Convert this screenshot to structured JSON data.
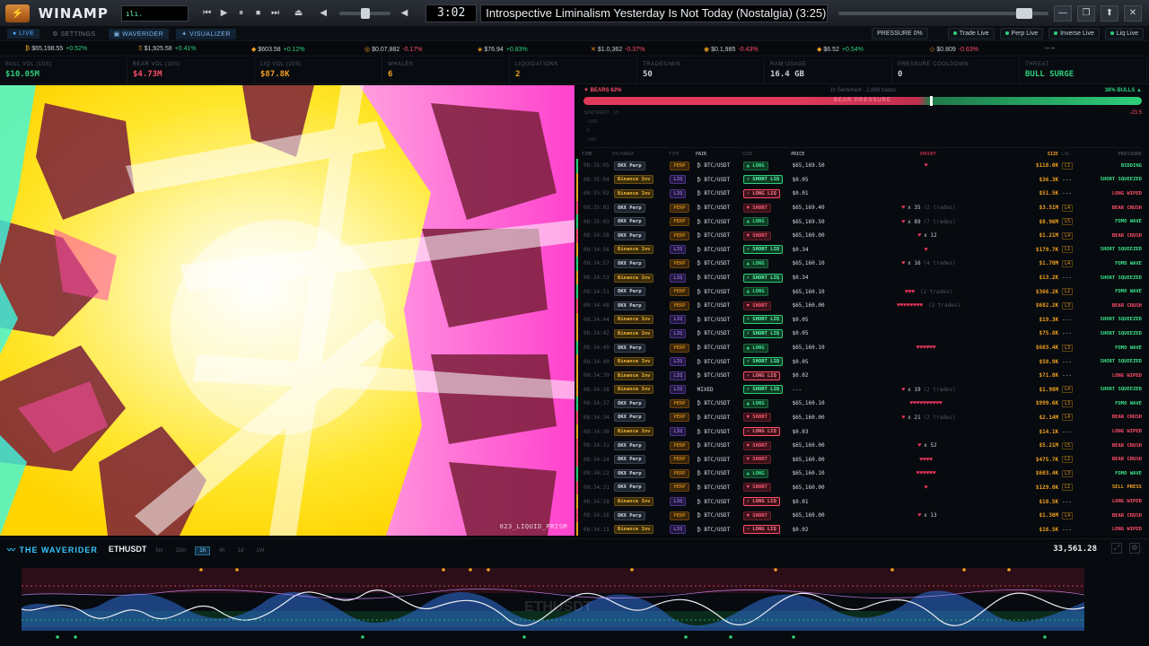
{
  "winamp": {
    "logo": "⚡",
    "title": "WINAMP",
    "vis_text": "ılı.",
    "controls": [
      "⏮",
      "▶",
      "⏸",
      "⏹",
      "⏭",
      "⏏"
    ],
    "time": "3:02",
    "song": "Introspective Liminalism Yesterday Is Not Today (Nostalgia) (3:25)",
    "window_buttons": [
      "—",
      "❐",
      "⬆",
      "✕"
    ]
  },
  "nav": {
    "items": [
      {
        "label": "● LIVE",
        "active": true
      },
      {
        "label": "⚙ SETTINGS",
        "active": false
      },
      {
        "label": "▣ WAVERIDER",
        "active": true
      },
      {
        "label": "✦ VISUALIZER",
        "active": true
      }
    ],
    "status": [
      "PRESSURE 0%",
      "Trade Live",
      "Perp Live",
      "Inverse Live",
      "Liq Live"
    ]
  },
  "ticker": [
    {
      "icon": "₿",
      "price": "$65,198.55",
      "chg": "+0.52%",
      "dir": "up"
    },
    {
      "icon": "Ξ",
      "price": "$1,925.58",
      "chg": "+0.41%",
      "dir": "up"
    },
    {
      "icon": "◆",
      "price": "$603.58",
      "chg": "+0.12%",
      "dir": "up"
    },
    {
      "icon": "◎",
      "price": "$0.07,882",
      "chg": "-0.17%",
      "dir": "dn"
    },
    {
      "icon": "◈",
      "price": "$76.94",
      "chg": "+0.83%",
      "dir": "up"
    },
    {
      "icon": "✕",
      "price": "$1.0,362",
      "chg": "-0.37%",
      "dir": "dn"
    },
    {
      "icon": "◉",
      "price": "$0.1,985",
      "chg": "-0.43%",
      "dir": "dn"
    },
    {
      "icon": "◆",
      "price": "$6.52",
      "chg": "+0.54%",
      "dir": "up"
    },
    {
      "icon": "◇",
      "price": "$0.809",
      "chg": "-0.63%",
      "dir": "dn"
    },
    {
      "icon": "",
      "price": "-- --",
      "chg": "",
      "dir": "up"
    }
  ],
  "stats": [
    {
      "label": "BULL VOL (10S)",
      "value": "$10.05M",
      "color": "#2ecf7a"
    },
    {
      "label": "BEAR VOL (10S)",
      "value": "$4.73M",
      "color": "#ff4d6a"
    },
    {
      "label": "LIQ VOL (10S)",
      "value": "$87.8K",
      "color": "#f0a020"
    },
    {
      "label": "WHALES",
      "value": "6",
      "color": "#f0a020"
    },
    {
      "label": "LIQUIDATIONS",
      "value": "2",
      "color": "#f0a020"
    },
    {
      "label": "TRADES/MIN",
      "value": "50",
      "color": "#c8d0da"
    },
    {
      "label": "RAM USAGE",
      "value": "16.4 GB",
      "color": "#c8d0da"
    },
    {
      "label": "PRESSURE COOLDOWN",
      "value": "0",
      "color": "#c8d0da"
    },
    {
      "label": "THREAT",
      "value": "BULL SURGE",
      "color": "#2ecf7a"
    }
  ],
  "visualizer": {
    "preset": "023_LIQUID_PRISM"
  },
  "sentiment": {
    "bears": "▼ BEARS 62%",
    "center": "1h Sentiment · 2,888 trades",
    "bulls": "38% BULLS ▲",
    "bar_label": "BEAR PRESSURE",
    "bear_fraction": 0.62,
    "chart_label": "SENTIMENT · 1H",
    "chart_value": "-23.5",
    "axis": [
      "+100",
      "0",
      "-100"
    ]
  },
  "trade_headers": [
    "TIME",
    "EXCHANGE",
    "TYPE",
    "PAIR",
    "SIDE",
    "PRICE",
    "AMOUNT",
    "SIZE",
    "LVL",
    "PRESSURE"
  ],
  "trades": [
    {
      "time": "08:35:05",
      "ex": "OKX Perp",
      "type": "PERP",
      "pair": "₿ BTC/USDT",
      "side": "▲ LONG",
      "sc": "long",
      "price": "$65,169.50",
      "amt": "♥",
      "cnt": "",
      "tn": "",
      "size": "$118.0K",
      "lvl": "L1",
      "pr": "BIDDING",
      "pc": "p-g",
      "row": "bull"
    },
    {
      "time": "08:35:04",
      "ex": "Binance Inv",
      "type": "LIQ",
      "pair": "₿ BTC/USDT",
      "side": "⚡ SHORT LIQ",
      "sc": "sliq",
      "price": "$0.05",
      "amt": "",
      "cnt": "",
      "tn": "",
      "size": "$36.3K",
      "lvl": "---",
      "pr": "SHORT SQUEEZED",
      "pc": "p-g",
      "row": "liq"
    },
    {
      "time": "08:35:02",
      "ex": "Binance Inv",
      "type": "LIQ",
      "pair": "₿ BTC/USDT",
      "side": "⚡ LONG LIQ",
      "sc": "lliq",
      "price": "$0.01",
      "amt": "",
      "cnt": "",
      "tn": "",
      "size": "$51.5K",
      "lvl": "---",
      "pr": "LONG WIPED",
      "pc": "p-r",
      "row": "liq"
    },
    {
      "time": "08:35:03",
      "ex": "OKX Perp",
      "type": "PERP",
      "pair": "₿ BTC/USDT",
      "side": "▼ SHORT",
      "sc": "short",
      "price": "$65,169.40",
      "amt": "♥",
      "cnt": "x 35",
      "tn": "(2 trades)",
      "size": "$3.51M",
      "lvl": "L4",
      "pr": "BEAR CRUSH",
      "pc": "p-r",
      "row": "bear"
    },
    {
      "time": "08:35:03",
      "ex": "OKX Perp",
      "type": "PERP",
      "pair": "₿ BTC/USDT",
      "side": "▲ LONG",
      "sc": "long",
      "price": "$65,169.50",
      "amt": "♥",
      "cnt": "x 89",
      "tn": "(7 trades)",
      "size": "$8.96M",
      "lvl": "L5",
      "pr": "FOMO WAVE",
      "pc": "p-g",
      "row": "bull"
    },
    {
      "time": "08:34:58",
      "ex": "OKX Perp",
      "type": "PERP",
      "pair": "₿ BTC/USDT",
      "side": "▼ SHORT",
      "sc": "short",
      "price": "$65,160.00",
      "amt": "♥",
      "cnt": "x 12",
      "tn": "",
      "size": "$1.21M",
      "lvl": "L4",
      "pr": "BEAR CRUSH",
      "pc": "p-r",
      "row": "bear"
    },
    {
      "time": "08:34:56",
      "ex": "Binance Inv",
      "type": "LIQ",
      "pair": "₿ BTC/USDT",
      "side": "⚡ SHORT LIQ",
      "sc": "sliq",
      "price": "$0.34",
      "amt": "♥",
      "cnt": "",
      "tn": "",
      "size": "$179.7K",
      "lvl": "L1",
      "pr": "SHORT SQUEEZED",
      "pc": "p-g",
      "row": "liq"
    },
    {
      "time": "08:34:57",
      "ex": "OKX Perp",
      "type": "PERP",
      "pair": "₿ BTC/USDT",
      "side": "▲ LONG",
      "sc": "long",
      "price": "$65,160.10",
      "amt": "♥",
      "cnt": "x 16",
      "tn": "(4 trades)",
      "size": "$1.70M",
      "lvl": "L4",
      "pr": "FOMO WAVE",
      "pc": "p-g",
      "row": "bull"
    },
    {
      "time": "08:34:53",
      "ex": "Binance Inv",
      "type": "LIQ",
      "pair": "₿ BTC/USDT",
      "side": "⚡ SHORT LIQ",
      "sc": "sliq",
      "price": "$0.34",
      "amt": "",
      "cnt": "",
      "tn": "",
      "size": "$13.2K",
      "lvl": "---",
      "pr": "SHORT SQUEEZED",
      "pc": "p-g",
      "row": "liq"
    },
    {
      "time": "08:34:51",
      "ex": "OKX Perp",
      "type": "PERP",
      "pair": "₿ BTC/USDT",
      "side": "▲ LONG",
      "sc": "long",
      "price": "$65,160.10",
      "amt": "♥♥♥",
      "cnt": "",
      "tn": "(2 trades)",
      "size": "$366.2K",
      "lvl": "L2",
      "pr": "FOMO WAVE",
      "pc": "p-g",
      "row": "bull"
    },
    {
      "time": "08:34:48",
      "ex": "OKX Perp",
      "type": "PERP",
      "pair": "₿ BTC/USDT",
      "side": "▼ SHORT",
      "sc": "short",
      "price": "$65,160.00",
      "amt": "♥♥♥♥♥♥♥♥",
      "cnt": "",
      "tn": "(2 trades)",
      "size": "$682.2K",
      "lvl": "L3",
      "pr": "BEAR CRUSH",
      "pc": "p-r",
      "row": "bear"
    },
    {
      "time": "08:34:44",
      "ex": "Binance Inv",
      "type": "LIQ",
      "pair": "₿ BTC/USDT",
      "side": "⚡ SHORT LIQ",
      "sc": "sliq",
      "price": "$0.05",
      "amt": "",
      "cnt": "",
      "tn": "",
      "size": "$19.3K",
      "lvl": "---",
      "pr": "SHORT SQUEEZED",
      "pc": "p-g",
      "row": "liq"
    },
    {
      "time": "08:34:42",
      "ex": "Binance Inv",
      "type": "LIQ",
      "pair": "₿ BTC/USDT",
      "side": "⚡ SHORT LIQ",
      "sc": "sliq",
      "price": "$0.05",
      "amt": "",
      "cnt": "",
      "tn": "",
      "size": "$75.8K",
      "lvl": "---",
      "pr": "SHORT SQUEEZED",
      "pc": "p-g",
      "row": "liq"
    },
    {
      "time": "08:34:40",
      "ex": "OKX Perp",
      "type": "PERP",
      "pair": "₿ BTC/USDT",
      "side": "▲ LONG",
      "sc": "long",
      "price": "$65,160.10",
      "amt": "♥♥♥♥♥♥",
      "cnt": "",
      "tn": "",
      "size": "$603.4K",
      "lvl": "L3",
      "pr": "FOMO WAVE",
      "pc": "p-g",
      "row": "bull"
    },
    {
      "time": "08:34:40",
      "ex": "Binance Inv",
      "type": "LIQ",
      "pair": "₿ BTC/USDT",
      "side": "⚡ SHORT LIQ",
      "sc": "sliq",
      "price": "$0.05",
      "amt": "",
      "cnt": "",
      "tn": "",
      "size": "$58.9K",
      "lvl": "---",
      "pr": "SHORT SQUEEZED",
      "pc": "p-g",
      "row": "liq"
    },
    {
      "time": "08:34:39",
      "ex": "Binance Inv",
      "type": "LIQ",
      "pair": "₿ BTC/USDT",
      "side": "⚡ LONG LIQ",
      "sc": "lliq",
      "price": "$0.02",
      "amt": "",
      "cnt": "",
      "tn": "",
      "size": "$71.8K",
      "lvl": "---",
      "pr": "LONG WIPED",
      "pc": "p-r",
      "row": "liq"
    },
    {
      "time": "08:34:38",
      "ex": "Binance Inv",
      "type": "LIQ",
      "pair": "MIXED",
      "side": "⚡ SHORT LIQ",
      "sc": "sliq",
      "price": "---",
      "amt": "♥",
      "cnt": "x 19",
      "tn": "(2 trades)",
      "size": "$1.98M",
      "lvl": "L4",
      "pr": "SHORT SQUEEZED",
      "pc": "p-g",
      "row": "liq"
    },
    {
      "time": "08:34:37",
      "ex": "OKX Perp",
      "type": "PERP",
      "pair": "₿ BTC/USDT",
      "side": "▲ LONG",
      "sc": "long",
      "price": "$65,160.10",
      "amt": "♥♥♥♥♥♥♥♥♥♥",
      "cnt": "",
      "tn": "",
      "size": "$999.6K",
      "lvl": "L3",
      "pr": "FOMO WAVE",
      "pc": "p-g",
      "row": "bull"
    },
    {
      "time": "08:34:34",
      "ex": "OKX Perp",
      "type": "PERP",
      "pair": "₿ BTC/USDT",
      "side": "▼ SHORT",
      "sc": "short",
      "price": "$65,160.00",
      "amt": "♥",
      "cnt": "x 21",
      "tn": "(2 trades)",
      "size": "$2.14M",
      "lvl": "L4",
      "pr": "BEAR CRUSH",
      "pc": "p-r",
      "row": "bear"
    },
    {
      "time": "08:34:30",
      "ex": "Binance Inv",
      "type": "LIQ",
      "pair": "₿ BTC/USDT",
      "side": "⚡ LONG LIQ",
      "sc": "lliq",
      "price": "$0.03",
      "amt": "",
      "cnt": "",
      "tn": "",
      "size": "$14.1K",
      "lvl": "---",
      "pr": "LONG WIPED",
      "pc": "p-r",
      "row": "liq"
    },
    {
      "time": "08:34:31",
      "ex": "OKX Perp",
      "type": "PERP",
      "pair": "₿ BTC/USDT",
      "side": "▼ SHORT",
      "sc": "short",
      "price": "$65,160.00",
      "amt": "♥",
      "cnt": "x 52",
      "tn": "",
      "size": "$5.21M",
      "lvl": "L5",
      "pr": "BEAR CRUSH",
      "pc": "p-r",
      "row": "bear"
    },
    {
      "time": "08:34:24",
      "ex": "OKX Perp",
      "type": "PERP",
      "pair": "₿ BTC/USDT",
      "side": "▼ SHORT",
      "sc": "short",
      "price": "$65,160.00",
      "amt": "♥♥♥♥",
      "cnt": "",
      "tn": "",
      "size": "$475.7K",
      "lvl": "L2",
      "pr": "BEAR CRUSH",
      "pc": "p-r",
      "row": "bear"
    },
    {
      "time": "08:34:22",
      "ex": "OKX Perp",
      "type": "PERP",
      "pair": "₿ BTC/USDT",
      "side": "▲ LONG",
      "sc": "long",
      "price": "$65,160.10",
      "amt": "♥♥♥♥♥♥",
      "cnt": "",
      "tn": "",
      "size": "$603.4K",
      "lvl": "L3",
      "pr": "FOMO WAVE",
      "pc": "p-g",
      "row": "bull"
    },
    {
      "time": "08:34:21",
      "ex": "OKX Perp",
      "type": "PERP",
      "pair": "₿ BTC/USDT",
      "side": "▼ SHORT",
      "sc": "short",
      "price": "$65,160.00",
      "amt": "♥",
      "cnt": "",
      "tn": "",
      "size": "$129.0K",
      "lvl": "L1",
      "pr": "SELL PRESS",
      "pc": "p-o",
      "row": "bear"
    },
    {
      "time": "08:34:18",
      "ex": "Binance Inv",
      "type": "LIQ",
      "pair": "₿ BTC/USDT",
      "side": "⚡ LONG LIQ",
      "sc": "lliq",
      "price": "$0.01",
      "amt": "",
      "cnt": "",
      "tn": "",
      "size": "$10.5K",
      "lvl": "---",
      "pr": "LONG WIPED",
      "pc": "p-r",
      "row": "liq"
    },
    {
      "time": "08:34:16",
      "ex": "OKX Perp",
      "type": "PERP",
      "pair": "₿ BTC/USDT",
      "side": "▼ SHORT",
      "sc": "short",
      "price": "$65,160.00",
      "amt": "♥",
      "cnt": "x 13",
      "tn": "",
      "size": "$1.30M",
      "lvl": "L4",
      "pr": "BEAR CRUSH",
      "pc": "p-r",
      "row": "bear"
    },
    {
      "time": "08:34:15",
      "ex": "Binance Inv",
      "type": "LIQ",
      "pair": "₿ BTC/USDT",
      "side": "⚡ LONG LIQ",
      "sc": "lliq",
      "price": "$0.02",
      "amt": "",
      "cnt": "",
      "tn": "",
      "size": "$16.5K",
      "lvl": "---",
      "pr": "LONG WIPED",
      "pc": "p-r",
      "row": "liq"
    }
  ],
  "waverider": {
    "title": "〰 THE WAVERIDER",
    "symbol": "ETHUSDT",
    "timeframes": [
      {
        "l": "5m",
        "on": false
      },
      {
        "l": "15m",
        "on": false
      },
      {
        "l": "1h",
        "on": true
      },
      {
        "l": "4h",
        "on": false
      },
      {
        "l": "1d",
        "on": false
      },
      {
        "l": "1W",
        "on": false
      }
    ],
    "price": "33,561.28",
    "watermark": "ETHUSDT"
  }
}
